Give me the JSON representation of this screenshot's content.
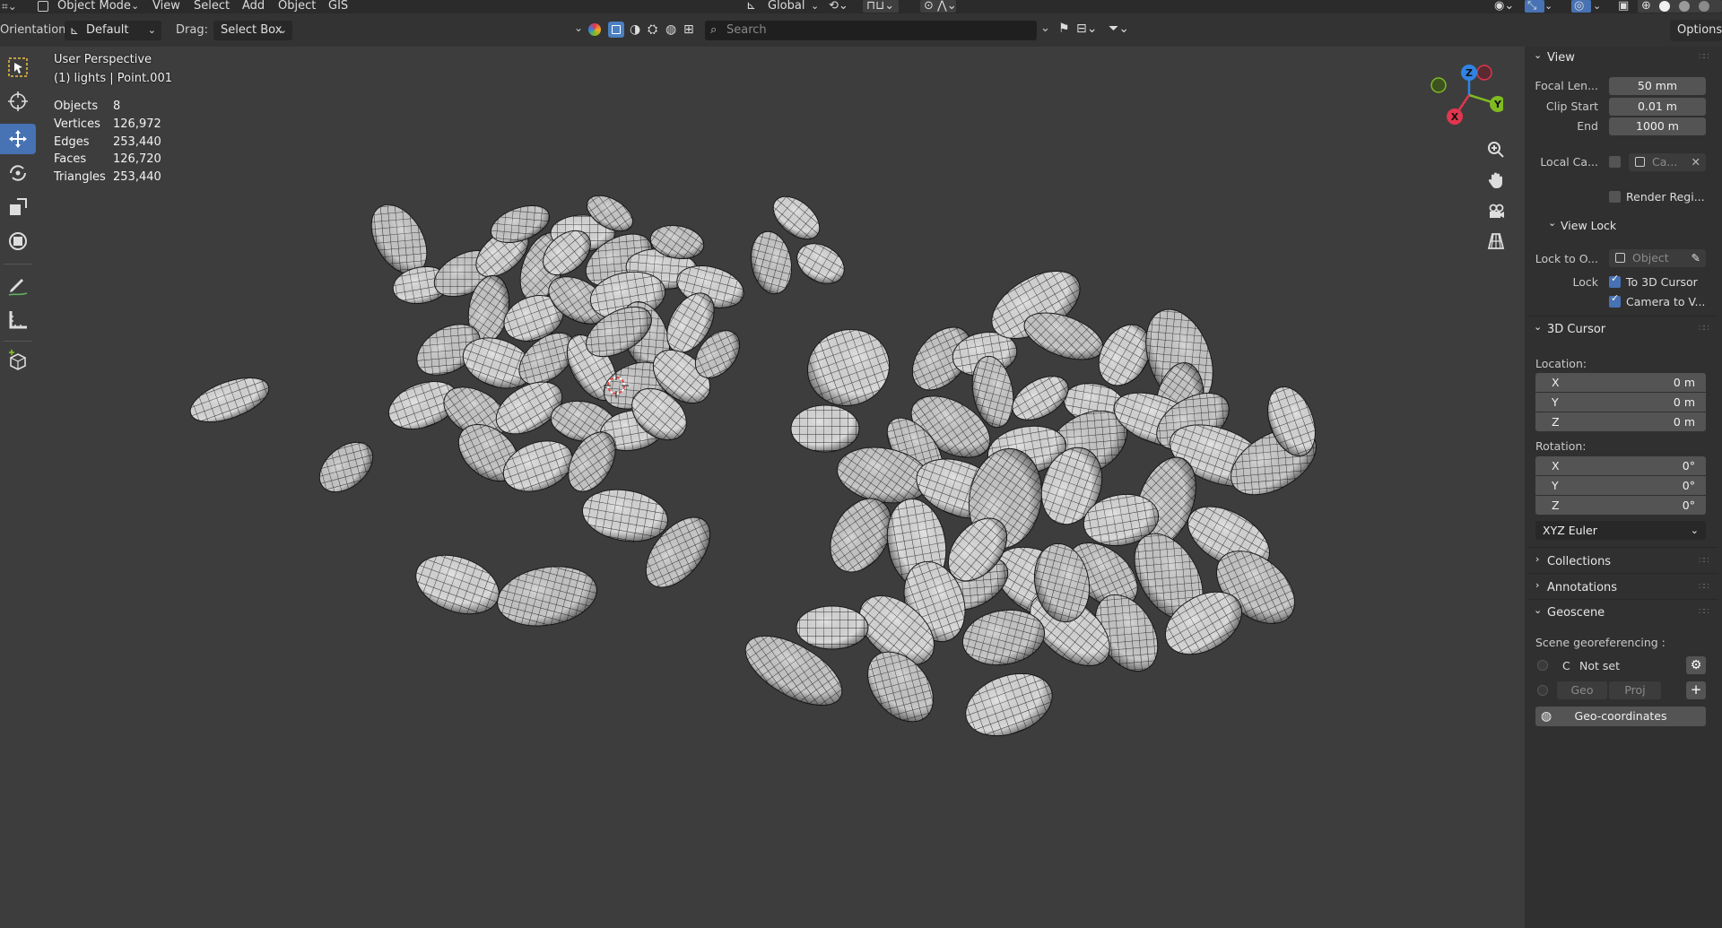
{
  "topbar": {
    "mode": "Object Mode",
    "menus": [
      "View",
      "Select",
      "Add",
      "Object",
      "GIS"
    ],
    "transform_orientation": "Global"
  },
  "toolheader": {
    "orientation_label": "Orientation:",
    "orientation_value": "Default",
    "drag_label": "Drag:",
    "drag_value": "Select Box",
    "search_placeholder": "Search",
    "options": "Options"
  },
  "overlay": {
    "view_name": "User Perspective",
    "collection": "(1) lights | Point.001",
    "stats": [
      {
        "label": "Objects",
        "value": "8"
      },
      {
        "label": "Vertices",
        "value": "126,972"
      },
      {
        "label": "Edges",
        "value": "253,440"
      },
      {
        "label": "Faces",
        "value": "126,720"
      },
      {
        "label": "Triangles",
        "value": "253,440"
      }
    ]
  },
  "gizmo": {
    "x": "X",
    "y": "Y",
    "z": "Z"
  },
  "npanel": {
    "view": {
      "header": "View",
      "focal_label": "Focal Len...",
      "focal_value": "50 mm",
      "clip_start_label": "Clip Start",
      "clip_start_value": "0.01 m",
      "clip_end_label": "End",
      "clip_end_value": "1000 m",
      "local_camera_label": "Local Ca...",
      "local_camera_value": "Ca...",
      "render_region": "Render Regi..."
    },
    "view_lock": {
      "header": "View Lock",
      "lock_to_label": "Lock to O...",
      "lock_to_placeholder": "Object",
      "lock_label": "Lock",
      "to_cursor": "To 3D Cursor",
      "camera_to_view": "Camera to V..."
    },
    "cursor": {
      "header": "3D Cursor",
      "location_label": "Location:",
      "location": [
        {
          "axis": "X",
          "value": "0 m"
        },
        {
          "axis": "Y",
          "value": "0 m"
        },
        {
          "axis": "Z",
          "value": "0 m"
        }
      ],
      "rotation_label": "Rotation:",
      "rotation": [
        {
          "axis": "X",
          "value": "0°"
        },
        {
          "axis": "Y",
          "value": "0°"
        },
        {
          "axis": "Z",
          "value": "0°"
        }
      ],
      "rotation_mode": "XYZ Euler"
    },
    "collections": "Collections",
    "annotations": "Annotations",
    "geoscene": {
      "header": "Geoscene",
      "scene_georef": "Scene georeferencing :",
      "crs_letter": "C",
      "not_set": "Not set",
      "geo": "Geo",
      "proj": "Proj",
      "geo_coordinates": "Geo-coordinates"
    }
  },
  "colors": {
    "viewport_bg": "#3d3d3d",
    "accent": "#4772b3",
    "axis_x": "#e0364f",
    "axis_y": "#7fbb21",
    "axis_z": "#2f83e3"
  }
}
